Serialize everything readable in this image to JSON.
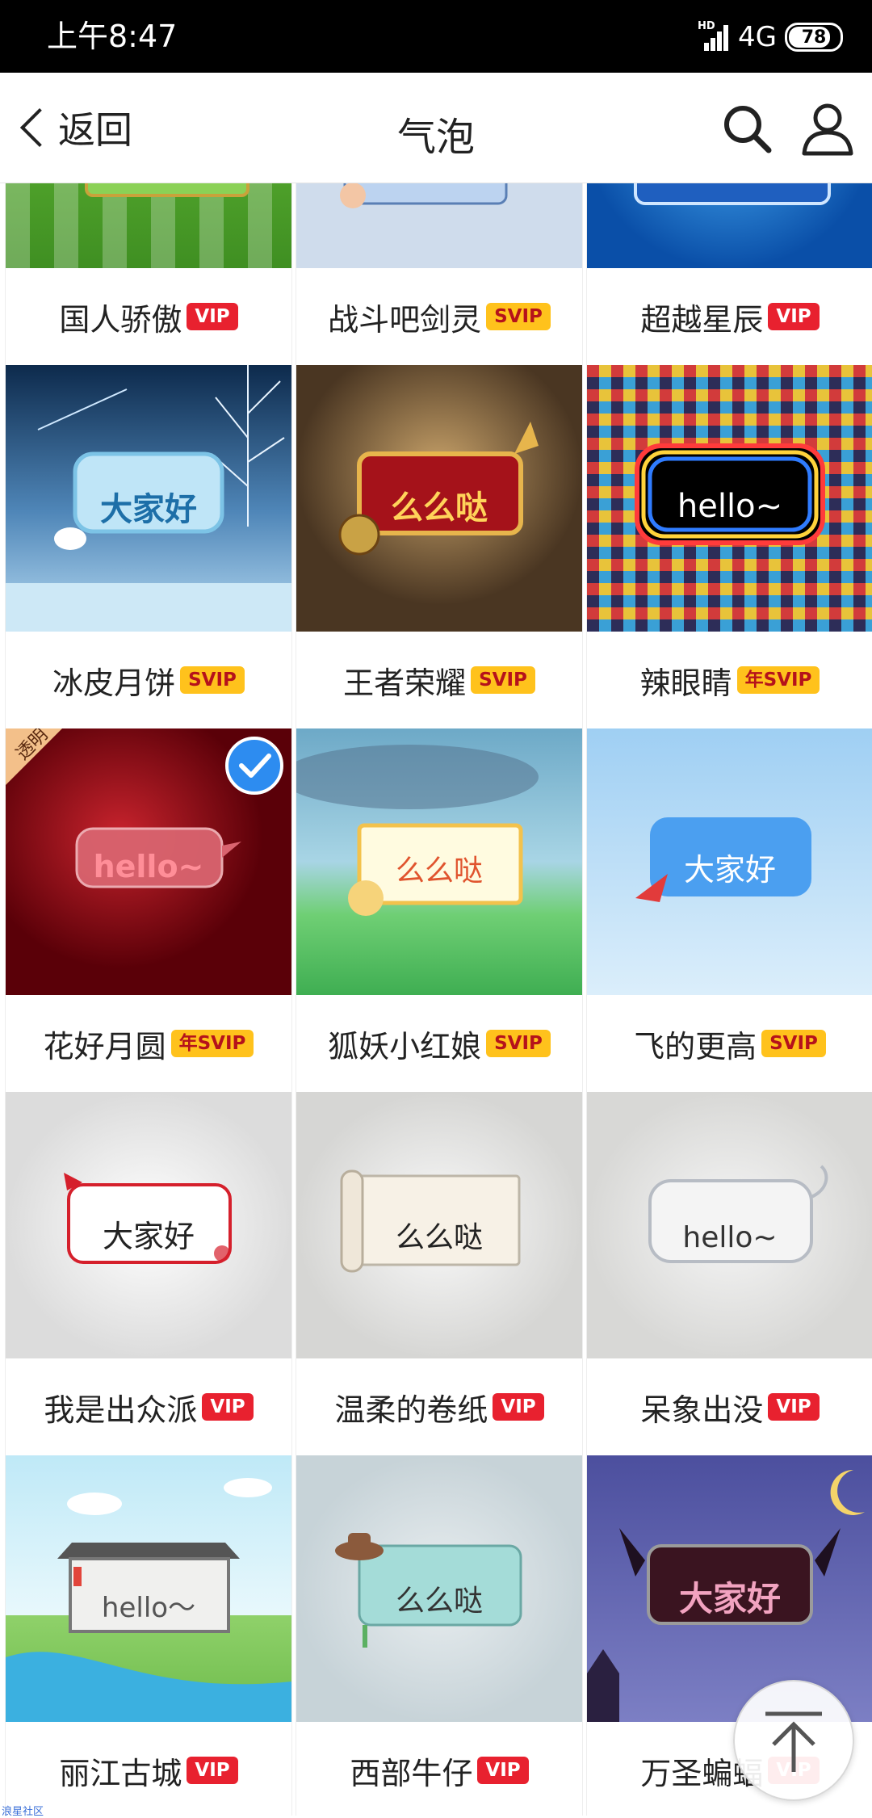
{
  "status_bar": {
    "time": "上午8:47",
    "network": "4G",
    "hd": "HD",
    "battery": "78"
  },
  "nav": {
    "back_label": "返回",
    "title": "气泡",
    "search_icon": "search-icon",
    "profile_icon": "user-icon"
  },
  "items": [
    {
      "name": "国人骄傲",
      "badge": "VIP",
      "preview_text": ""
    },
    {
      "name": "战斗吧剑灵",
      "badge": "SVIP",
      "preview_text": ""
    },
    {
      "name": "超越星辰",
      "badge": "VIP",
      "preview_text": ""
    },
    {
      "name": "冰皮月饼",
      "badge": "SVIP",
      "preview_text": "大家好"
    },
    {
      "name": "王者荣耀",
      "badge": "SVIP",
      "preview_text": "么么哒"
    },
    {
      "name": "辣眼睛",
      "badge": "年SVIP",
      "preview_text": "hello~"
    },
    {
      "name": "花好月圆",
      "badge": "年SVIP",
      "preview_text": "hello~",
      "corner_tag": "透明",
      "selected": true
    },
    {
      "name": "狐妖小红娘",
      "badge": "SVIP",
      "preview_text": "么么哒"
    },
    {
      "name": "飞的更高",
      "badge": "SVIP",
      "preview_text": "大家好"
    },
    {
      "name": "我是出众派",
      "badge": "VIP",
      "preview_text": "大家好"
    },
    {
      "name": "温柔的卷纸",
      "badge": "VIP",
      "preview_text": "么么哒"
    },
    {
      "name": "呆象出没",
      "badge": "VIP",
      "preview_text": "hello~"
    },
    {
      "name": "丽江古城",
      "badge": "VIP",
      "preview_text": "hello～"
    },
    {
      "name": "西部牛仔",
      "badge": "VIP",
      "preview_text": "么么哒"
    },
    {
      "name": "万圣蝙蝠",
      "badge": "VIP",
      "preview_text": "大家好"
    }
  ],
  "badge_colors": {
    "VIP": "#e8212f",
    "SVIP": "#ffc21c"
  },
  "scroll_top_icon": "arrow-up-icon",
  "watermark": "浪星社区"
}
